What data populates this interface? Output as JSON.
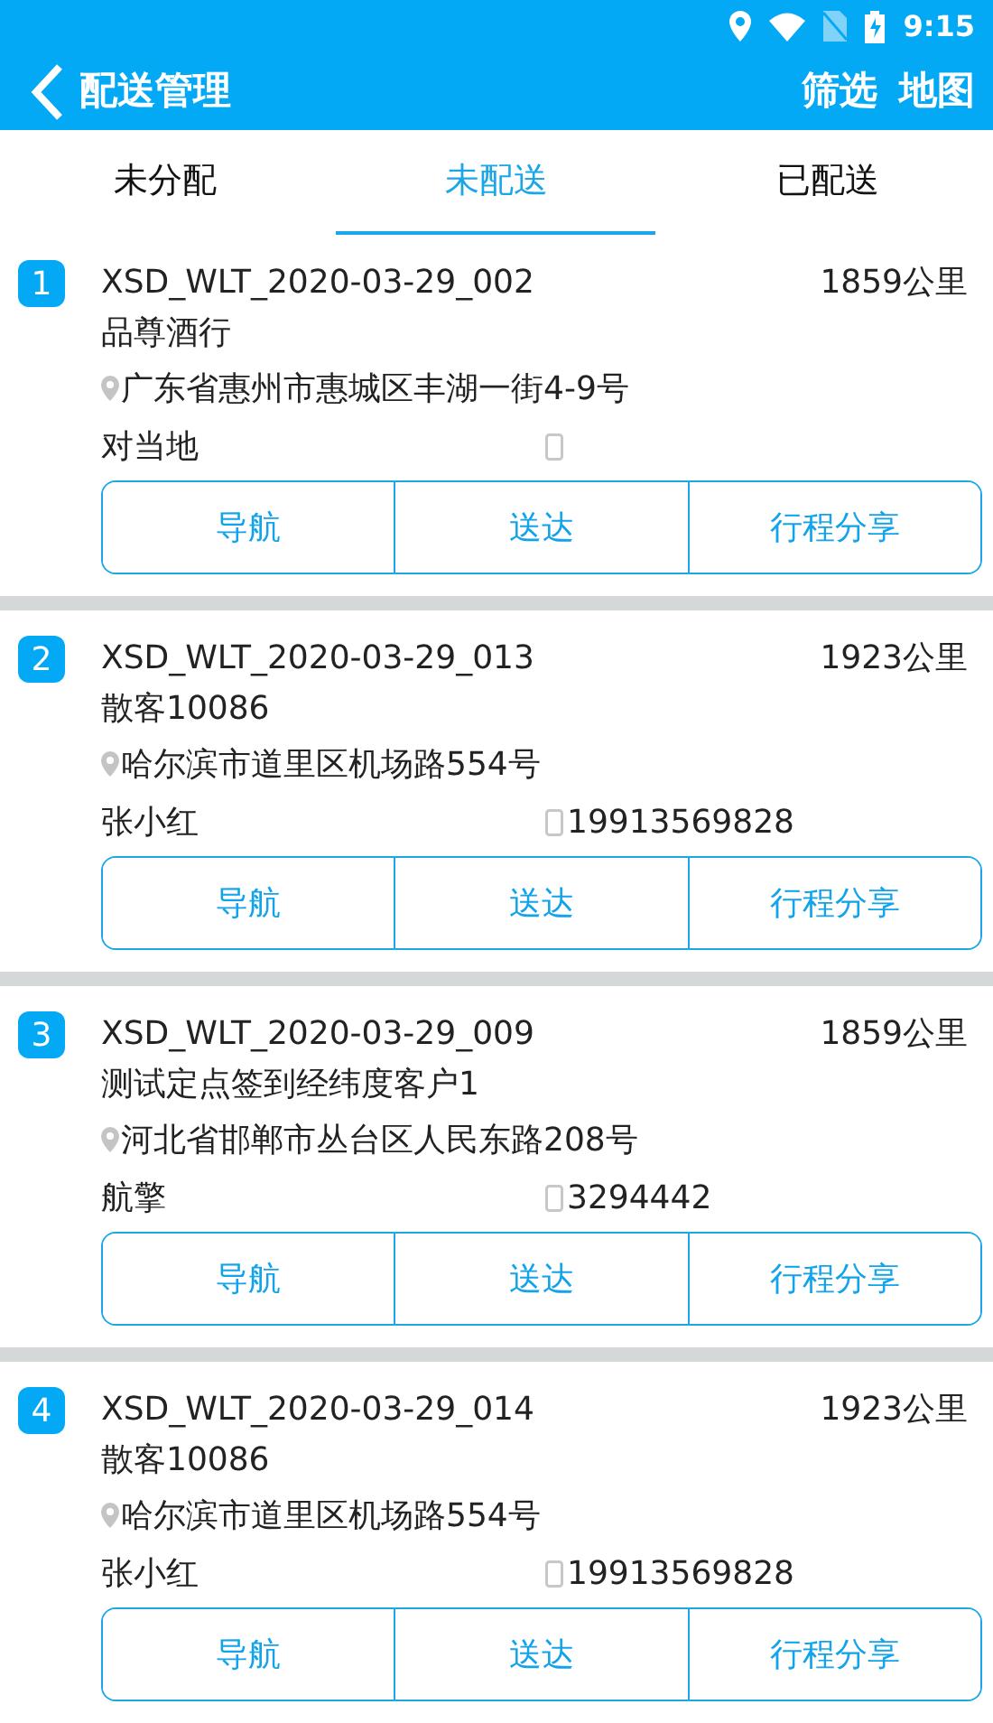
{
  "status_bar": {
    "time": "9:15"
  },
  "header": {
    "title": "配送管理",
    "actions": [
      "筛选",
      "地图"
    ]
  },
  "tabs": [
    {
      "label": "未分配",
      "selected": false
    },
    {
      "label": "未配送",
      "selected": true
    },
    {
      "label": "已配送",
      "selected": false
    }
  ],
  "orders": [
    {
      "index": "1",
      "code": "XSD_WLT_2020-03-29_002",
      "distance": "1859公里",
      "customer": "品尊酒行",
      "address": "广东省惠州市惠城区丰湖一街4-9号",
      "contact": "对当地",
      "actions": [
        "导航",
        "送达",
        "行程分享"
      ]
    },
    {
      "index": "2",
      "code": "XSD_WLT_2020-03-29_013",
      "distance": "1923公里",
      "customer": "散客10086",
      "address": "哈尔滨市道里区机场路554号",
      "contact": "张小红",
      "phone": "19913569828",
      "actions": [
        "导航",
        "送达",
        "行程分享"
      ]
    },
    {
      "index": "3",
      "code": "XSD_WLT_2020-03-29_009",
      "distance": "1859公里",
      "customer": "测试定点签到经纬度客户1",
      "address": "河北省邯郸市丛台区人民东路208号",
      "contact": "航擎",
      "phone": "3294442",
      "actions": [
        "导航",
        "送达",
        "行程分享"
      ]
    },
    {
      "index": "4",
      "code": "XSD_WLT_2020-03-29_014",
      "distance": "1923公里",
      "customer": "散客10086",
      "address": "哈尔滨市道里区机场路554号",
      "contact": "张小红",
      "phone": "19913569828",
      "actions": [
        "导航",
        "送达",
        "行程分享"
      ]
    }
  ]
}
